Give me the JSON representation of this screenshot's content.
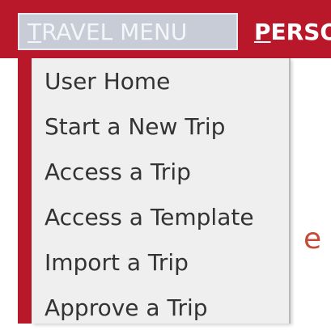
{
  "top_nav": {
    "active_tab": {
      "first_letter": "T",
      "rest": "RAVEL MENU"
    },
    "next_tab": {
      "first_letter": "P",
      "rest": "ERSO"
    }
  },
  "dropdown": {
    "items": [
      {
        "label": "User Home"
      },
      {
        "label": "Start a New Trip"
      },
      {
        "label": "Access a Trip"
      },
      {
        "label": "Access a Template"
      },
      {
        "label": "Import a Trip"
      },
      {
        "label": "Approve a Trip"
      }
    ]
  },
  "background_text": "e",
  "colors": {
    "brand_red": "#b8182a",
    "menu_bg": "#efefef"
  }
}
